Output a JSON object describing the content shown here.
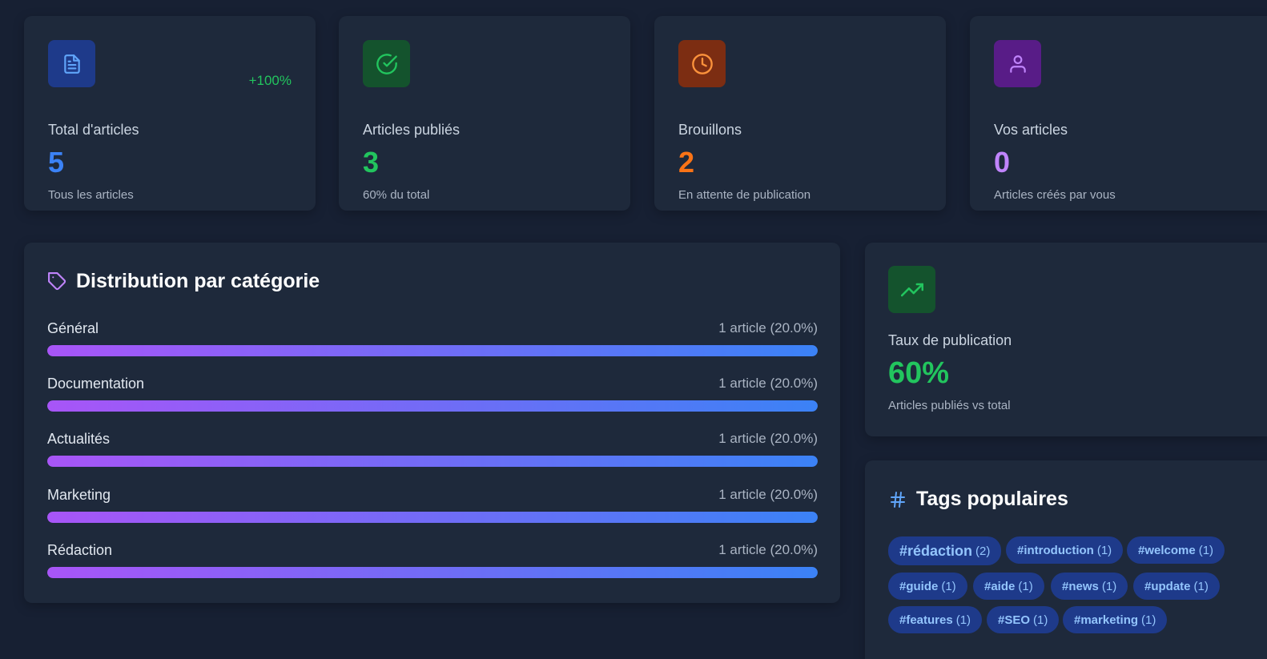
{
  "stats": [
    {
      "label": "Total d'articles",
      "value": "5",
      "sub": "Tous les articles",
      "trend": "+100%",
      "icon": "document-icon",
      "value_color": "#3b82f6",
      "icon_bg": "#1e3a8a",
      "icon_color": "#60a5fa"
    },
    {
      "label": "Articles publiés",
      "value": "3",
      "sub": "60% du total",
      "trend": "",
      "icon": "check-circle-icon",
      "value_color": "#22c55e",
      "icon_bg": "#14532d",
      "icon_color": "#22c55e"
    },
    {
      "label": "Brouillons",
      "value": "2",
      "sub": "En attente de publication",
      "trend": "",
      "icon": "clock-icon",
      "value_color": "#f97316",
      "icon_bg": "#7c2d12",
      "icon_color": "#fb923c"
    },
    {
      "label": "Vos articles",
      "value": "0",
      "sub": "Articles créés par vous",
      "trend": "",
      "icon": "user-icon",
      "value_color": "#c084fc",
      "icon_bg": "#581c87",
      "icon_color": "#c084fc"
    }
  ],
  "categories": {
    "title": "Distribution par catégorie",
    "icon": "tag-icon",
    "items": [
      {
        "name": "Général",
        "count": "1 article (20.0%)",
        "fill": 1.0
      },
      {
        "name": "Documentation",
        "count": "1 article (20.0%)",
        "fill": 1.0
      },
      {
        "name": "Actualités",
        "count": "1 article (20.0%)",
        "fill": 1.0
      },
      {
        "name": "Marketing",
        "count": "1 article (20.0%)",
        "fill": 1.0
      },
      {
        "name": "Rédaction",
        "count": "1 article (20.0%)",
        "fill": 1.0
      }
    ]
  },
  "publication_rate": {
    "label": "Taux de publication",
    "value": "60%",
    "sub": "Articles publiés vs total",
    "icon": "trending-up-icon"
  },
  "tags": {
    "title": "Tags populaires",
    "icon": "hash-icon",
    "items": [
      {
        "name": "#rédaction",
        "count": "(2)"
      },
      {
        "name": "#introduction",
        "count": "(1)"
      },
      {
        "name": "#welcome",
        "count": "(1)"
      },
      {
        "name": "#guide",
        "count": "(1)"
      },
      {
        "name": "#aide",
        "count": "(1)"
      },
      {
        "name": "#news",
        "count": "(1)"
      },
      {
        "name": "#update",
        "count": "(1)"
      },
      {
        "name": "#features",
        "count": "(1)"
      },
      {
        "name": "#SEO",
        "count": "(1)"
      },
      {
        "name": "#marketing",
        "count": "(1)"
      }
    ]
  }
}
